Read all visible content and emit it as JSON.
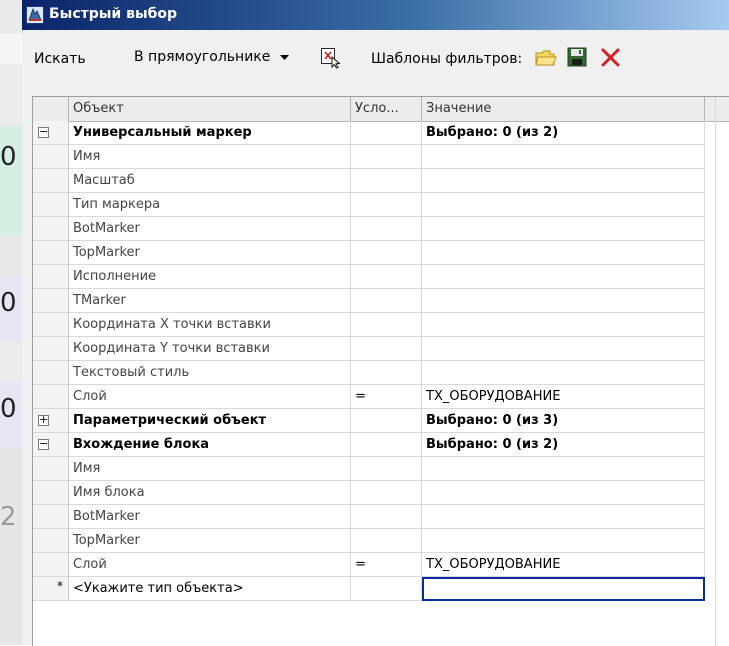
{
  "window": {
    "title": "Быстрый выбор"
  },
  "background_app": {
    "values": [
      "0",
      "0",
      "0",
      "2"
    ]
  },
  "toolbar": {
    "search_label": "Искать",
    "scope_dropdown": "В прямоугольнике",
    "filter_templates_label": "Шаблоны фильтров:"
  },
  "grid": {
    "headers": {
      "object": "Объект",
      "condition": "Усло...",
      "value": "Значение"
    },
    "rows": [
      {
        "kind": "group",
        "toggle": "−",
        "object": "Универсальный маркер",
        "condition": "",
        "value": "Выбрано: 0 (из 2)"
      },
      {
        "kind": "prop",
        "object": "Имя",
        "condition": "",
        "value": ""
      },
      {
        "kind": "prop",
        "object": "Масштаб",
        "condition": "",
        "value": ""
      },
      {
        "kind": "prop",
        "object": "Тип маркера",
        "condition": "",
        "value": ""
      },
      {
        "kind": "prop",
        "object": "BotMarker",
        "condition": "",
        "value": ""
      },
      {
        "kind": "prop",
        "object": "TopMarker",
        "condition": "",
        "value": ""
      },
      {
        "kind": "prop",
        "object": "Исполнение",
        "condition": "",
        "value": ""
      },
      {
        "kind": "prop",
        "object": "TMarker",
        "condition": "",
        "value": ""
      },
      {
        "kind": "prop",
        "object": "Координата X точки вставки",
        "condition": "",
        "value": ""
      },
      {
        "kind": "prop",
        "object": "Координата Y точки вставки",
        "condition": "",
        "value": ""
      },
      {
        "kind": "prop",
        "object": "Текстовый стиль",
        "condition": "",
        "value": ""
      },
      {
        "kind": "prop",
        "object": "Слой",
        "condition": "=",
        "value": "ТХ_ОБОРУДОВАНИЕ"
      },
      {
        "kind": "group",
        "toggle": "+",
        "object": "Параметрический объект",
        "condition": "",
        "value": "Выбрано: 0 (из 3)"
      },
      {
        "kind": "group",
        "toggle": "−",
        "object": "Вхождение блока",
        "condition": "",
        "value": "Выбрано: 0 (из 2)"
      },
      {
        "kind": "prop",
        "object": "Имя",
        "condition": "",
        "value": ""
      },
      {
        "kind": "prop",
        "object": "Имя блока",
        "condition": "",
        "value": ""
      },
      {
        "kind": "prop",
        "object": "BotMarker",
        "condition": "",
        "value": ""
      },
      {
        "kind": "prop",
        "object": "TopMarker",
        "condition": "",
        "value": ""
      },
      {
        "kind": "prop",
        "object": "Слой",
        "condition": "=",
        "value": "ТХ_ОБОРУДОВАНИЕ"
      },
      {
        "kind": "new",
        "marker": "*",
        "object": "<Укажите тип объекта>",
        "condition": "",
        "value": ""
      }
    ]
  },
  "colors": {
    "titlebar_start": "#0a246a",
    "titlebar_end": "#a6caf0",
    "delete_red": "#d42020",
    "focus_border": "#0b2a9e"
  },
  "icons": [
    "app-icon",
    "select-objects-icon",
    "open-folder-icon",
    "save-icon",
    "delete-icon",
    "dropdown-arrow-icon"
  ]
}
